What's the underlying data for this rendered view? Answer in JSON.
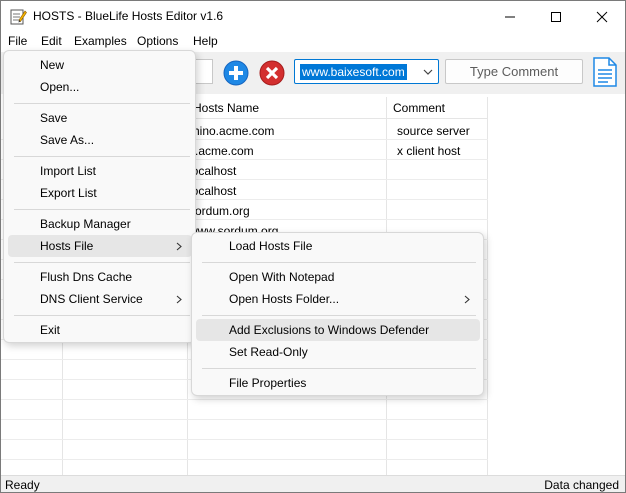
{
  "window": {
    "title": "HOSTS - BlueLife Hosts Editor v1.6",
    "controls": [
      "minimize",
      "maximize",
      "close"
    ]
  },
  "menubar": {
    "items": [
      "File",
      "Edit",
      "Examples",
      "Options",
      "Help"
    ]
  },
  "toolbar": {
    "search_value": "www.baixesoft.com",
    "comment_placeholder": "Type Comment"
  },
  "table": {
    "columns": [
      "Hosts Name",
      "Comment"
    ],
    "rows": [
      {
        "host": "rhino.acme.com",
        "comment": "source server"
      },
      {
        "host": "x.acme.com",
        "comment": "x client host"
      },
      {
        "host": "localhost",
        "comment": ""
      },
      {
        "host": "localhost",
        "comment": ""
      },
      {
        "host": "sordum.org",
        "comment": ""
      },
      {
        "host": "www.sordum.org",
        "comment": ""
      }
    ]
  },
  "file_menu": {
    "items": [
      "New",
      "Open...",
      "Save",
      "Save As...",
      "Import List",
      "Export List",
      "Backup Manager",
      "Hosts File",
      "Flush Dns Cache",
      "DNS Client Service",
      "Exit"
    ]
  },
  "hosts_submenu": {
    "items": [
      "Load Hosts File",
      "Open With Notepad",
      "Open Hosts Folder...",
      "Add Exclusions to Windows Defender",
      "Set Read-Only",
      "File Properties"
    ]
  },
  "status": {
    "left": "Ready",
    "right": "Data changed"
  },
  "colors": {
    "accent": "#0078d7",
    "add_icon": "#1e88e5",
    "delete_icon": "#d32f2f"
  }
}
